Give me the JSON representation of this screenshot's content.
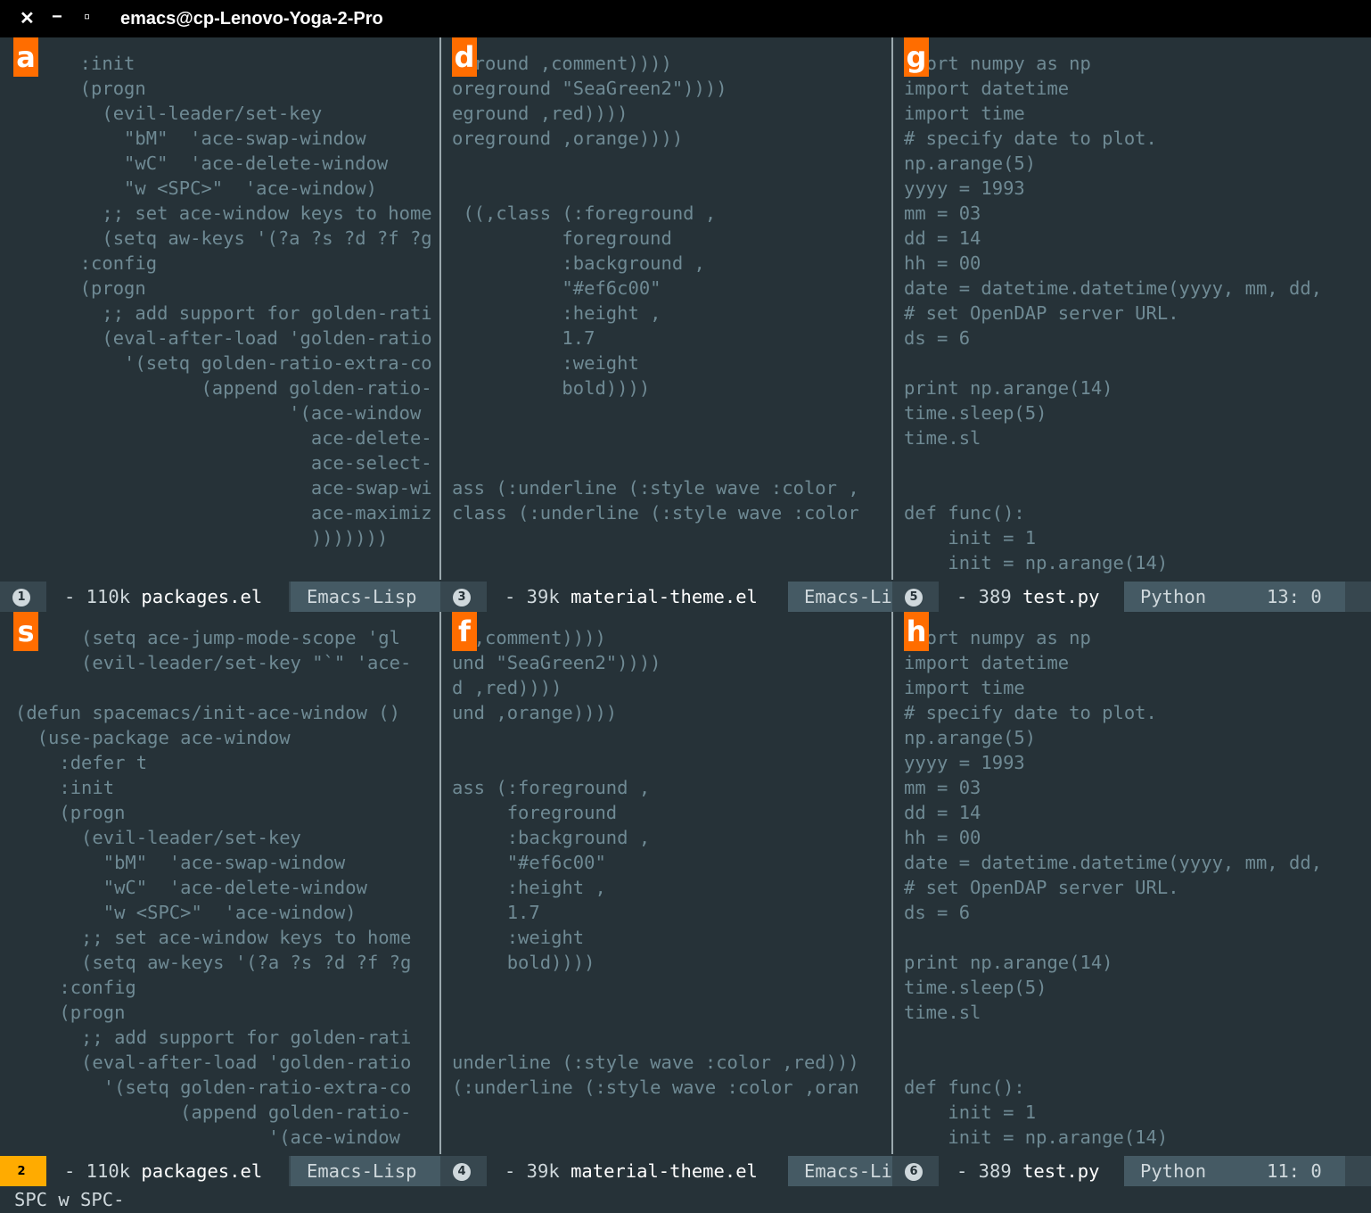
{
  "window": {
    "title": "emacs@cp-Lenovo-Yoga-2-Pro",
    "close": "✕",
    "minimize": "−",
    "maximize": "▫"
  },
  "panes": {
    "a": {
      "label": "a",
      "lines": [
        "  :init",
        "  (progn",
        "    (evil-leader/set-key",
        "      \"bM\"  'ace-swap-window",
        "      \"wC\"  'ace-delete-window",
        "      \"w <SPC>\"  'ace-window)",
        "    ;; set ace-window keys to home",
        "    (setq aw-keys '(?a ?s ?d ?f ?g",
        "  :config",
        "  (progn",
        "    ;; add support for golden-rati",
        "    (eval-after-load 'golden-ratio",
        "      '(setq golden-ratio-extra-co",
        "             (append golden-ratio-",
        "                     '(ace-window",
        "                       ace-delete-",
        "                       ace-select-",
        "                       ace-swap-wi",
        "                       ace-maximiz",
        "                       )))))))"
      ]
    },
    "d": {
      "label": "d",
      "lines": [
        "eground ,comment))))",
        "oreground \"SeaGreen2\"))))",
        "eground ,red))))",
        "oreground ,orange))))",
        "",
        "",
        " ((,class (:foreground ,",
        "          foreground",
        "          :background ,",
        "          \"#ef6c00\"",
        "          :height ,",
        "          1.7",
        "          :weight",
        "          bold))))",
        "",
        "",
        "",
        "ass (:underline (:style wave :color ,",
        "class (:underline (:style wave :color"
      ]
    },
    "g": {
      "label": "g",
      "lines": [
        "mport numpy as np",
        "import datetime",
        "import time",
        "# specify date to plot.",
        "np.arange(5)",
        "yyyy = 1993",
        "mm = 03",
        "dd = 14",
        "hh = 00",
        "date = datetime.datetime(yyyy, mm, dd,",
        "# set OpenDAP server URL.",
        "ds = 6",
        "",
        "print np.arange(14)",
        "time.sleep(5)",
        "time.sl",
        "",
        "",
        "def func():",
        "    init = 1",
        "    init = np.arange(14)"
      ]
    },
    "s": {
      "label": "s",
      "lines": [
        "      (setq ace-jump-mode-scope 'gl",
        "      (evil-leader/set-key \"`\" 'ace-",
        "",
        "(defun spacemacs/init-ace-window ()",
        "  (use-package ace-window",
        "    :defer t",
        "    :init",
        "    (progn",
        "      (evil-leader/set-key",
        "        \"bM\"  'ace-swap-window",
        "        \"wC\"  'ace-delete-window",
        "        \"w <SPC>\"  'ace-window)",
        "      ;; set ace-window keys to home",
        "      (setq aw-keys '(?a ?s ?d ?f ?g",
        "    :config",
        "    (progn",
        "      ;; add support for golden-rati",
        "      (eval-after-load 'golden-ratio",
        "        '(setq golden-ratio-extra-co",
        "               (append golden-ratio-",
        "                       '(ace-window"
      ]
    },
    "f": {
      "label": "f",
      "lines": [
        "d ,comment))))",
        "und \"SeaGreen2\"))))",
        "d ,red))))",
        "und ,orange))))",
        "",
        "",
        "ass (:foreground ,",
        "     foreground",
        "     :background ,",
        "     \"#ef6c00\"",
        "     :height ,",
        "     1.7",
        "     :weight",
        "     bold))))",
        "",
        "",
        "",
        "underline (:style wave :color ,red)))",
        "(:underline (:style wave :color ,oran"
      ]
    },
    "h": {
      "label": "h",
      "lines": [
        "mport numpy as np",
        "import datetime",
        "import time",
        "# specify date to plot.",
        "np.arange(5)",
        "yyyy = 1993",
        "mm = 03",
        "dd = 14",
        "hh = 00",
        "date = datetime.datetime(yyyy, mm, dd,",
        "# set OpenDAP server URL.",
        "ds = 6",
        "",
        "print np.arange(14)",
        "time.sleep(5)",
        "time.sl",
        "",
        "",
        "def func():",
        "    init = 1",
        "    init = np.arange(14)"
      ]
    }
  },
  "modelines": {
    "top": [
      {
        "num": "1",
        "buffer_prefix": "- 110k ",
        "buffer": "packages.el",
        "mode": "Emacs-Lisp"
      },
      {
        "num": "3",
        "buffer_prefix": "- 39k ",
        "buffer": "material-theme.el",
        "mode": "Emacs-Li"
      },
      {
        "num": "5",
        "buffer_prefix": "- 389 ",
        "buffer": "test.py",
        "mode": "Python",
        "pos": "13: 0"
      }
    ],
    "bottom": [
      {
        "num": "2",
        "buffer_prefix": "- 110k ",
        "buffer": "packages.el",
        "mode": "Emacs-Lisp"
      },
      {
        "num": "4",
        "buffer_prefix": "- 39k ",
        "buffer": "material-theme.el",
        "mode": "Emacs-Li"
      },
      {
        "num": "6",
        "buffer_prefix": "- 389 ",
        "buffer": "test.py",
        "mode": "Python",
        "pos": "11: 0"
      }
    ]
  },
  "echo_area": "SPC w SPC-",
  "colors": {
    "bg": "#263238",
    "text": "#6f8a94",
    "label": "#ff6d00",
    "cursor": "#ffab00",
    "modeline": "#37474f"
  }
}
